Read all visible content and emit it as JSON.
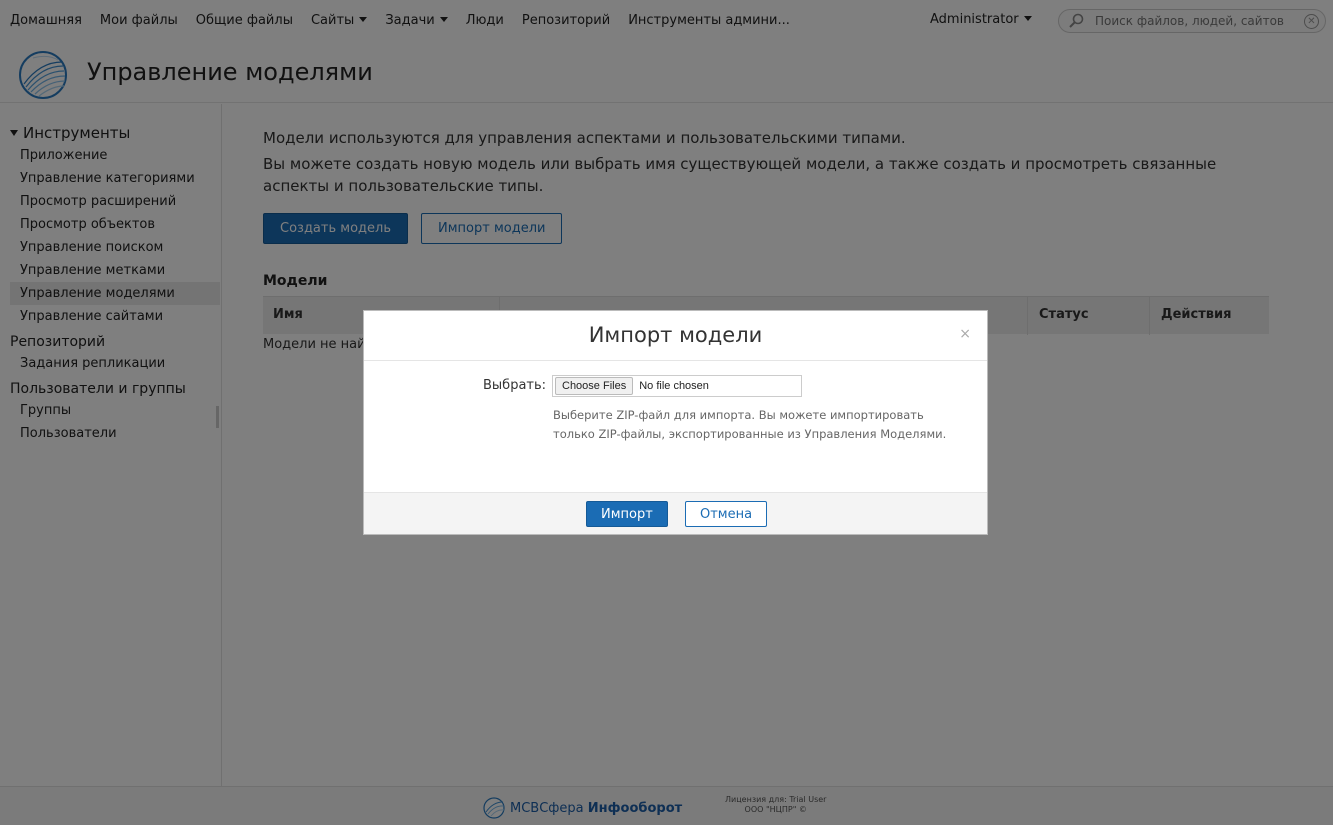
{
  "nav": {
    "items": [
      {
        "label": "Домашняя",
        "dropdown": false
      },
      {
        "label": "Мои файлы",
        "dropdown": false
      },
      {
        "label": "Общие файлы",
        "dropdown": false
      },
      {
        "label": "Сайты",
        "dropdown": true
      },
      {
        "label": "Задачи",
        "dropdown": true
      },
      {
        "label": "Люди",
        "dropdown": false
      },
      {
        "label": "Репозиторий",
        "dropdown": false
      },
      {
        "label": "Инструменты админи...",
        "dropdown": false
      }
    ],
    "user_label": "Administrator",
    "search_placeholder": "Поиск файлов, людей, сайтов"
  },
  "header": {
    "title": "Управление моделями"
  },
  "sidebar": {
    "tools_title": "Инструменты",
    "tools": [
      {
        "label": "Приложение",
        "active": false
      },
      {
        "label": "Управление категориями",
        "active": false
      },
      {
        "label": "Просмотр расширений",
        "active": false
      },
      {
        "label": "Просмотр объектов",
        "active": false
      },
      {
        "label": "Управление поиском",
        "active": false
      },
      {
        "label": "Управление метками",
        "active": false
      },
      {
        "label": "Управление моделями",
        "active": true
      },
      {
        "label": "Управление сайтами",
        "active": false
      }
    ],
    "repository_title": "Репозиторий",
    "repository_items": [
      "Задания репликации"
    ],
    "users_title": "Пользователи и группы",
    "users_items": [
      "Группы",
      "Пользователи"
    ]
  },
  "main": {
    "intro_line1": "Модели используются для управления аспектами и пользовательскими типами.",
    "intro_line2": "Вы можете создать новую модель или выбрать имя существующей модели, а также создать и просмотреть связанные аспекты и пользовательские типы.",
    "create_button": "Создать модель",
    "import_button": "Импорт модели",
    "models_heading": "Модели",
    "columns": {
      "name": "Имя",
      "status": "Статус",
      "actions": "Действия"
    },
    "empty_text": "Модели не най"
  },
  "dialog": {
    "title": "Импорт модели",
    "close_symbol": "×",
    "field_label": "Выбрать:",
    "file_button": "Choose Files",
    "file_status": "No file chosen",
    "help_text": "Выберите ZIP-файл для импорта. Вы можете импортировать только ZIP-файлы, экспортированные из Управления Моделями.",
    "import_label": "Импорт",
    "cancel_label": "Отмена"
  },
  "footer": {
    "brand_prefix": "МСВСфера",
    "brand_suffix": "Инфооборот",
    "license_line1": "Лицензия для: Trial User",
    "license_line2": "ООО \"НЦПР\" ©"
  },
  "colors": {
    "accent": "#1b6cb4",
    "overlay": "#7f7f7f"
  }
}
